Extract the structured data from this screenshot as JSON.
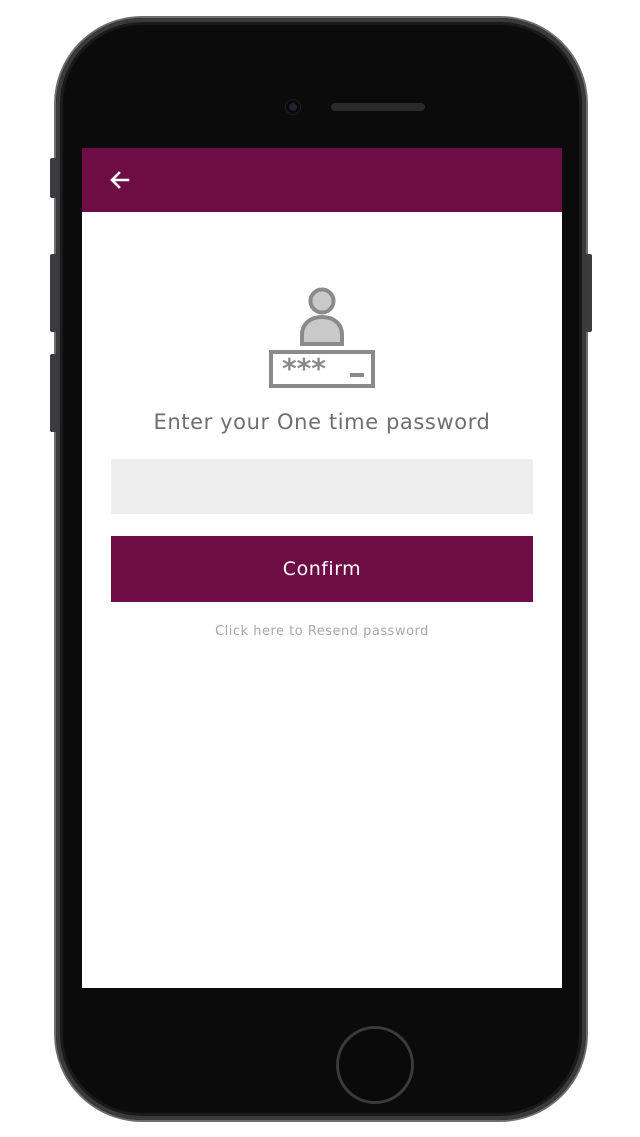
{
  "header": {
    "back_icon": "arrow-left-icon",
    "bar_color": "#6d0c45"
  },
  "otp_icon": "user-password-icon",
  "prompt": "Enter your One time password",
  "otp_field": {
    "value": "",
    "placeholder": ""
  },
  "confirm_label": "Confirm",
  "resend_label": "Click here to Resend password",
  "colors": {
    "accent": "#6d0c45",
    "input_bg": "#eeeeee",
    "prompt_text": "#6f6f6f",
    "link_text": "#a9a9a9"
  }
}
